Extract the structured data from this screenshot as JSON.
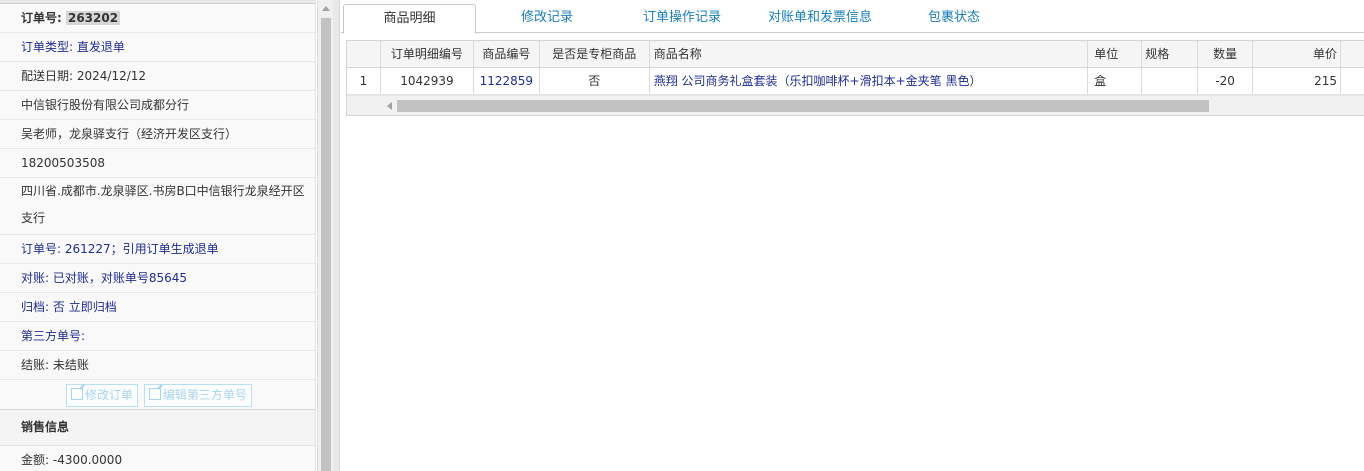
{
  "order": {
    "order_no_label": "订单号: ",
    "order_no_value": "263202",
    "order_type": "订单类型: 直发退单",
    "delivery_date": "配送日期: 2024/12/12",
    "company": "中信银行股份有限公司成都分行",
    "contact": "吴老师，龙泉驿支行（经济开发区支行）",
    "phone": "18200503508",
    "address": "四川省.成都市.龙泉驿区.书房B口中信银行龙泉经开区支行",
    "ref_order": "订单号: 261227；引用订单生成退单",
    "reconcile": "对账: 已对账，对账单号85645",
    "archive_label": "归档: 否",
    "archive_link": "立即归档",
    "third_party": "第三方单号:",
    "settle": "结账: 未结账",
    "edit_order_button": "修改订单",
    "edit_third_party_button": "编辑第三方单号",
    "sales_section_title": "销售信息",
    "amount": "金额: -4300.0000"
  },
  "tabs": [
    {
      "label": "商品明细"
    },
    {
      "label": "修改记录"
    },
    {
      "label": "订单操作记录"
    },
    {
      "label": "对账单和发票信息"
    },
    {
      "label": "包裹状态"
    }
  ],
  "grid": {
    "headers": [
      "",
      "订单明细编号",
      "商品编号",
      "是否是专柜商品",
      "商品名称",
      "单位",
      "规格",
      "数量",
      "单价"
    ],
    "rows": [
      [
        "1",
        "1042939",
        "1122859",
        "否",
        "燕翔 公司商务礼盒套装（乐扣咖啡杯+滑扣本+金夹笔 黑色）",
        "盒",
        "",
        "-20",
        "215"
      ]
    ]
  },
  "colors": {
    "link": "#1f2d8f",
    "tab_text": "#1a7fb8",
    "disabled_button": "#a9d4ea"
  }
}
